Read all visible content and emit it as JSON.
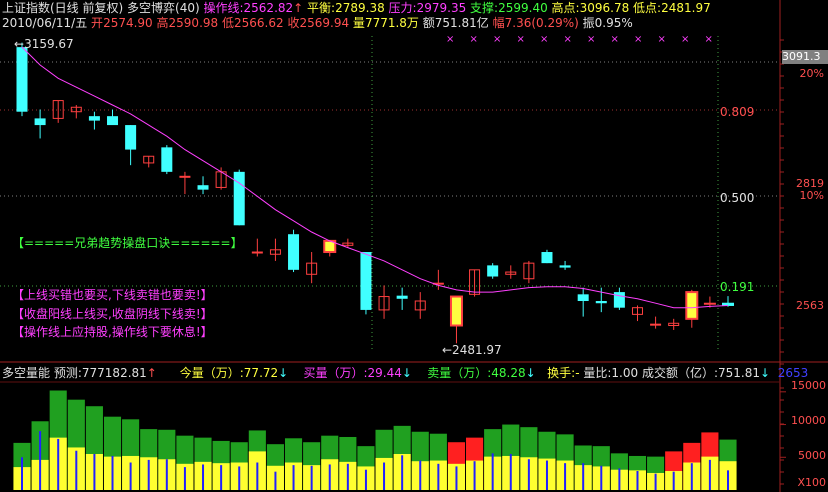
{
  "header": {
    "name": "上证指数(日线 前复权)",
    "indicator": "多空博弈(40)",
    "op_label": "操作线:",
    "op_value": "2562.82",
    "op_arrow": "↑",
    "balance_label": "平衡:",
    "balance_value": "2789.38",
    "resist_label": "压力:",
    "resist_value": "2979.35",
    "support_label": "支撑:",
    "support_value": "2599.40",
    "high_label": "高点:",
    "high_value": "3096.78",
    "low_label": "低点:",
    "low_value": "2481.97"
  },
  "quote": {
    "date": "2010/06/11/五",
    "open_label": "开",
    "open": "2574.90",
    "high_label": "高",
    "high": "2590.98",
    "low_label": "低",
    "low": "2566.62",
    "close_label": "收",
    "close": "2569.94",
    "vol_label": "量",
    "vol": "7771.8万",
    "amount_label": "额",
    "amount": "751.81亿",
    "range_label": "幅",
    "range": "7.36(0.29%)",
    "amp_label": "振",
    "amp": "0.95%"
  },
  "annotations": {
    "max_price": "3159.67",
    "max_prefix": "←",
    "min_price": "←2481.97",
    "fib_809": "0.809",
    "fib_500": "0.500",
    "fib_191": "0.191",
    "title_line": "【=====兄弟趋势操盘口诀======】",
    "rule1": "【上线买错也要买,下线卖错也要卖!】",
    "rule2": "【收盘阳线上线买,收盘阴线下线卖!】",
    "rule3": "【操作线上应持股,操作线下要休息!】"
  },
  "right_axis": {
    "price_tag": "3091.3",
    "pct_20": "20%",
    "p_2819": "2819",
    "pct_10": "10%",
    "p_2563": "2563",
    "v_15000": "15000",
    "v_10000": "10000",
    "v_5000": "5000",
    "unit": "X100"
  },
  "volume_header": {
    "name": "多空量能",
    "forecast_label": "预测:",
    "forecast": "777182.81",
    "forecast_arrow": "↑",
    "cur_label": "今量（万）:",
    "cur": "77.72",
    "cur_arrow": "↓",
    "buy_label": "买量（万）:",
    "buy": "29.44",
    "buy_arrow": "↓",
    "sell_label": "卖量（万）:",
    "sell": "48.28",
    "sell_arrow": "↓",
    "turn_label": "换手:",
    "turn": "-",
    "ratio_label": "量比:",
    "ratio": "1.00",
    "amount_label": "成交额（亿）:",
    "amount": "751.81",
    "amount_arrow": "↓",
    "extra": "2653"
  },
  "colors": {
    "up": "#ff4040",
    "down": "#40ffff",
    "ma": "#ff40ff",
    "vol_green": "#20a020",
    "vol_red": "#ff2020",
    "vol_yellow": "#ffff30",
    "vol_blue": "#2020ff",
    "grid": "#802020"
  },
  "chart_data": {
    "type": "candlestick",
    "candles": [
      {
        "o": 3150,
        "h": 3160,
        "l": 2995,
        "c": 3005
      },
      {
        "o": 2990,
        "h": 3010,
        "l": 2945,
        "c": 2975
      },
      {
        "o": 2990,
        "h": 3030,
        "l": 2980,
        "c": 3030
      },
      {
        "o": 3005,
        "h": 3020,
        "l": 2990,
        "c": 3015
      },
      {
        "o": 2995,
        "h": 3005,
        "l": 2965,
        "c": 2985
      },
      {
        "o": 2995,
        "h": 3010,
        "l": 2985,
        "c": 2975
      },
      {
        "o": 2975,
        "h": 2975,
        "l": 2885,
        "c": 2920
      },
      {
        "o": 2890,
        "h": 2905,
        "l": 2880,
        "c": 2905
      },
      {
        "o": 2925,
        "h": 2930,
        "l": 2865,
        "c": 2870
      },
      {
        "o": 2860,
        "h": 2870,
        "l": 2820,
        "c": 2860
      },
      {
        "o": 2840,
        "h": 2860,
        "l": 2820,
        "c": 2830
      },
      {
        "o": 2835,
        "h": 2880,
        "l": 2830,
        "c": 2870
      },
      {
        "o": 2870,
        "h": 2875,
        "l": 2750,
        "c": 2750
      },
      {
        "o": 2690,
        "h": 2720,
        "l": 2680,
        "c": 2690
      },
      {
        "o": 2685,
        "h": 2720,
        "l": 2670,
        "c": 2695
      },
      {
        "o": 2730,
        "h": 2740,
        "l": 2645,
        "c": 2650
      },
      {
        "o": 2640,
        "h": 2690,
        "l": 2620,
        "c": 2665
      },
      {
        "o": 2690,
        "h": 2715,
        "l": 2680,
        "c": 2715
      },
      {
        "o": 2705,
        "h": 2720,
        "l": 2700,
        "c": 2710
      },
      {
        "o": 2690,
        "h": 2690,
        "l": 2550,
        "c": 2560
      },
      {
        "o": 2560,
        "h": 2615,
        "l": 2540,
        "c": 2590
      },
      {
        "o": 2592,
        "h": 2610,
        "l": 2560,
        "c": 2585
      },
      {
        "o": 2560,
        "h": 2600,
        "l": 2540,
        "c": 2580
      },
      {
        "o": 2620,
        "h": 2650,
        "l": 2605,
        "c": 2620
      },
      {
        "o": 2525,
        "h": 2590,
        "l": 2485,
        "c": 2590
      },
      {
        "o": 2595,
        "h": 2650,
        "l": 2590,
        "c": 2650
      },
      {
        "o": 2660,
        "h": 2665,
        "l": 2630,
        "c": 2635
      },
      {
        "o": 2640,
        "h": 2660,
        "l": 2630,
        "c": 2645
      },
      {
        "o": 2630,
        "h": 2670,
        "l": 2620,
        "c": 2665
      },
      {
        "o": 2690,
        "h": 2695,
        "l": 2665,
        "c": 2665
      },
      {
        "o": 2660,
        "h": 2670,
        "l": 2650,
        "c": 2655
      },
      {
        "o": 2595,
        "h": 2610,
        "l": 2545,
        "c": 2580
      },
      {
        "o": 2580,
        "h": 2610,
        "l": 2555,
        "c": 2575
      },
      {
        "o": 2600,
        "h": 2610,
        "l": 2560,
        "c": 2565
      },
      {
        "o": 2550,
        "h": 2570,
        "l": 2535,
        "c": 2565
      },
      {
        "o": 2528,
        "h": 2545,
        "l": 2518,
        "c": 2528
      },
      {
        "o": 2525,
        "h": 2540,
        "l": 2515,
        "c": 2530
      },
      {
        "o": 2540,
        "h": 2605,
        "l": 2520,
        "c": 2600
      },
      {
        "o": 2575,
        "h": 2590,
        "l": 2565,
        "c": 2575
      },
      {
        "o": 2575,
        "h": 2591,
        "l": 2567,
        "c": 2570
      }
    ],
    "yellow_highlight": [
      17,
      24,
      37
    ],
    "ma": [
      3150,
      3110,
      3080,
      3060,
      3040,
      3020,
      3000,
      2975,
      2950,
      2920,
      2895,
      2870,
      2845,
      2815,
      2785,
      2760,
      2735,
      2715,
      2700,
      2685,
      2670,
      2650,
      2630,
      2615,
      2605,
      2600,
      2600,
      2605,
      2610,
      2612,
      2612,
      2608,
      2600,
      2592,
      2585,
      2575,
      2565,
      2565,
      2568,
      2570
    ],
    "ylim": [
      2470,
      3175
    ],
    "vol_green": [
      7200,
      10500,
      15200,
      13800,
      12800,
      11200,
      10800,
      9300,
      9200,
      8300,
      8000,
      7500,
      7300,
      9100,
      7000,
      7900,
      7300,
      8300,
      8100,
      6700,
      9200,
      9800,
      8900,
      8600,
      7300,
      8000,
      9300,
      10000,
      9600,
      8900,
      8500,
      6800,
      6700,
      5600,
      5200,
      5100,
      5900,
      7200,
      8800,
      7700
    ],
    "vol_red_idx": [
      24,
      25,
      36,
      37,
      38
    ],
    "vol_yellow": [
      3500,
      4600,
      8000,
      6500,
      5500,
      5100,
      5200,
      5000,
      4700,
      4000,
      4300,
      4100,
      4200,
      5900,
      3700,
      4200,
      3800,
      4700,
      4300,
      3600,
      4900,
      5500,
      4400,
      4500,
      4000,
      4500,
      5100,
      5200,
      5000,
      4800,
      4500,
      3800,
      3600,
      3100,
      3000,
      2600,
      2900,
      4200,
      5100,
      4400
    ],
    "vol_blue": [
      5000,
      9000,
      7800,
      6000,
      5500,
      5200,
      4200,
      4600,
      4700,
      3500,
      3900,
      3800,
      3600,
      4200,
      2800,
      3800,
      3700,
      3900,
      4000,
      3100,
      4200,
      5300,
      4500,
      4000,
      3600,
      4400,
      5600,
      5500,
      4700,
      4500,
      4100,
      4100,
      3700,
      3300,
      2900,
      2500,
      2800,
      4100,
      4600,
      3000
    ],
    "vol_ylim": [
      0,
      16500
    ]
  }
}
